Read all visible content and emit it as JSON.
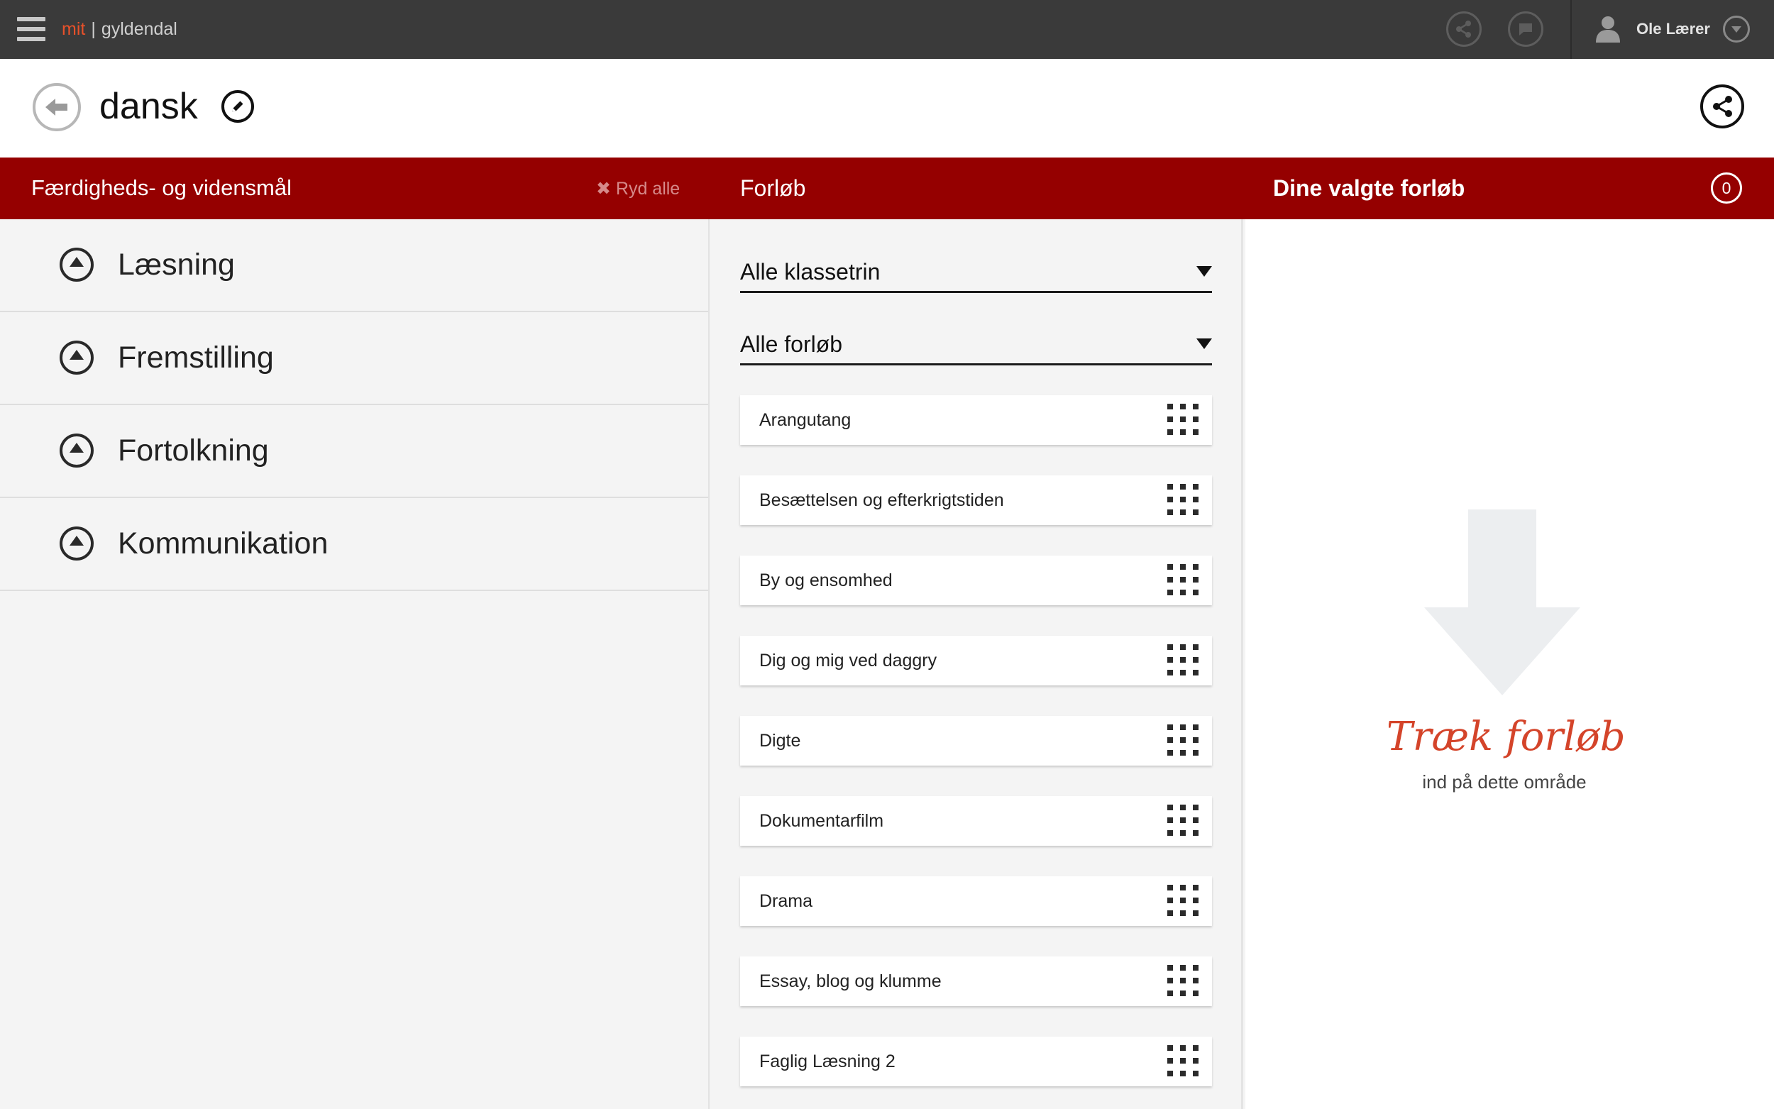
{
  "topbar": {
    "menu_icon": "hamburger-icon",
    "brand_mit": "mit",
    "brand_separator": "|",
    "brand_name": "gyldendal",
    "icons": [
      "share-icon",
      "chat-icon",
      "user-icon",
      "chevron-down-icon"
    ],
    "user_name": "Ole Lærer"
  },
  "title": {
    "text": "dansk",
    "back_icon": "back-arrow-icon",
    "edit_icon": "pencil-icon",
    "share_icon": "share-icon"
  },
  "header": {
    "left_title": "Færdigheds- og vidensmål",
    "clear_label": "✖ Ryd alle",
    "middle_title": "Forløb",
    "right_title": "Dine valgte forløb",
    "selected_count": "0"
  },
  "goals": [
    {
      "label": "Læsning"
    },
    {
      "label": "Fremstilling"
    },
    {
      "label": "Fortolkning"
    },
    {
      "label": "Kommunikation"
    }
  ],
  "filters": {
    "grade": "Alle klassetrin",
    "course_type": "Alle forløb"
  },
  "courses": [
    {
      "title": "Arangutang"
    },
    {
      "title": "Besættelsen og efterkrigtstiden"
    },
    {
      "title": "By og ensomhed"
    },
    {
      "title": "Dig og mig ved daggry"
    },
    {
      "title": "Digte"
    },
    {
      "title": "Dokumentarfilm"
    },
    {
      "title": "Drama"
    },
    {
      "title": "Essay, blog og klumme"
    },
    {
      "title": "Faglig Læsning 2"
    }
  ],
  "dropzone": {
    "script_text": "Træk forløb",
    "sub_text": "ind på dette område"
  },
  "colors": {
    "topbar": "#3a3a3a",
    "brand_accent": "#e8512a",
    "header_red": "#950000",
    "panel_bg": "#f4f4f4"
  }
}
